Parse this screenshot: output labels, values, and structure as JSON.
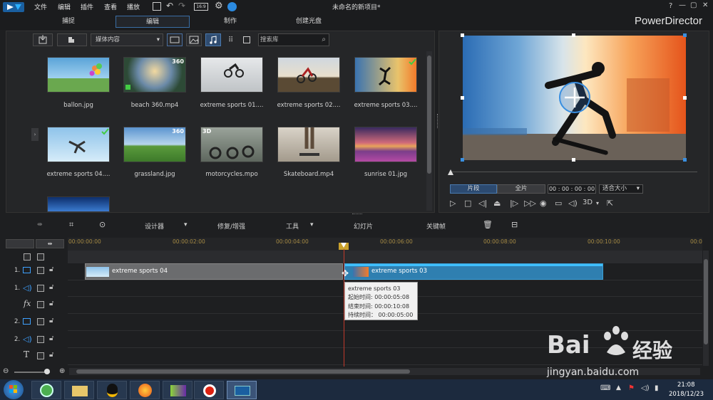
{
  "app": {
    "menu": [
      "文件",
      "编辑",
      "插件",
      "查看",
      "播放"
    ],
    "title": "未命名的新项目*",
    "brand": "PowerDirector",
    "window_controls": [
      "?",
      "—",
      "▢",
      "✕"
    ],
    "accent": "#3a6ea5"
  },
  "mode_tabs": [
    {
      "label": "捕捉",
      "active": false
    },
    {
      "label": "编辑",
      "active": true
    },
    {
      "label": "制作",
      "active": false
    },
    {
      "label": "创建光盘",
      "active": false
    }
  ],
  "library": {
    "dropdown": "媒体内容",
    "search_placeholder": "搜索库",
    "items": [
      {
        "name": "ballon.jpg",
        "badge": "",
        "check": false
      },
      {
        "name": "beach 360.mp4",
        "badge": "360",
        "check": false
      },
      {
        "name": "extreme sports 01....",
        "badge": "",
        "check": false
      },
      {
        "name": "extreme sports 02....",
        "badge": "",
        "check": false
      },
      {
        "name": "extreme sports 03....",
        "badge": "",
        "check": true
      },
      {
        "name": "extreme sports 04....",
        "badge": "",
        "check": true
      },
      {
        "name": "grassland.jpg",
        "badge": "360",
        "check": false
      },
      {
        "name": "motorcycles.mpo",
        "badge": "3D",
        "check": false
      },
      {
        "name": "Skateboard.mp4",
        "badge": "",
        "check": false
      },
      {
        "name": "sunrise 01.jpg",
        "badge": "",
        "check": false
      }
    ]
  },
  "preview": {
    "clip_tab": "片段",
    "full_tab": "全片",
    "timecode": "00 : 00 : 00 : 00",
    "fit_label": "适合大小",
    "mode_3d": "3D"
  },
  "timeline_toolbar": {
    "designer": "设计器",
    "fix_enhance": "修复/增强",
    "tools": "工具",
    "slideshow": "幻灯片",
    "keyframe": "关键帧"
  },
  "ruler_ticks": [
    "00:00:00:00",
    "00:00:02:00",
    "00:00:04:00",
    "00:00:06:00",
    "00:00:08:00",
    "00:00:10:00",
    "00:0"
  ],
  "tracks": [
    {
      "num": "",
      "icon": "",
      "row": 0
    },
    {
      "num": "1.",
      "icon": "video",
      "row": 1
    },
    {
      "num": "1.",
      "icon": "audio",
      "row": 2
    },
    {
      "num": "",
      "icon": "fx",
      "row": 3
    },
    {
      "num": "2.",
      "icon": "video",
      "row": 4
    },
    {
      "num": "2.",
      "icon": "audio",
      "row": 5
    },
    {
      "num": "",
      "icon": "text",
      "row": 6
    }
  ],
  "clips": [
    {
      "label": "extreme sports 04"
    },
    {
      "label": "extreme sports 03"
    }
  ],
  "tooltip": {
    "title": "extreme sports 03",
    "start": "起始时间: 00:00:05:08",
    "end": "结束时间: 00:00:10:08",
    "duration": "持续时间： 00:00:05:00"
  },
  "taskbar": {
    "time": "21:08",
    "date": "2018/12/23"
  },
  "watermark": {
    "brand": "Bai",
    "brand_cn": "经验",
    "url": "jingyan.baidu.com"
  }
}
